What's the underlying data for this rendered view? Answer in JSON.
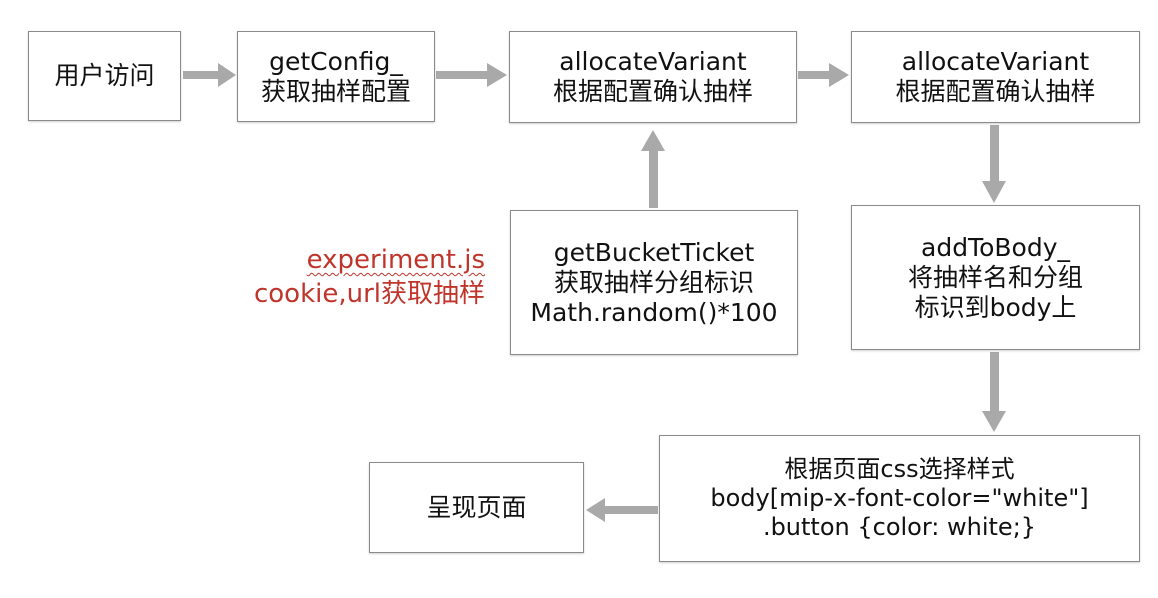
{
  "nodes": {
    "user_visit": [
      "用户访问"
    ],
    "get_config": [
      "getConfig_",
      "获取抽样配置"
    ],
    "allocate_variant_1": [
      "allocateVariant",
      "根据配置确认抽样"
    ],
    "allocate_variant_2": [
      "allocateVariant",
      "根据配置确认抽样"
    ],
    "get_bucket_ticket": [
      "getBucketTicket",
      "获取抽样分组标识",
      "Math.random()*100"
    ],
    "add_to_body": [
      "addToBody_",
      "将抽样名和分组",
      "标识到body上"
    ],
    "css_select": [
      "根据页面css选择样式",
      "body[mip-x-font-color=\"white\"]",
      ".button {color: white;}"
    ],
    "render_page": [
      "呈现页面"
    ]
  },
  "note": [
    "experiment.js",
    "cookie,url获取抽样"
  ],
  "colors": {
    "arrow": "#a9a9a9",
    "border": "#8a8a8a",
    "note": "#c0352b"
  }
}
